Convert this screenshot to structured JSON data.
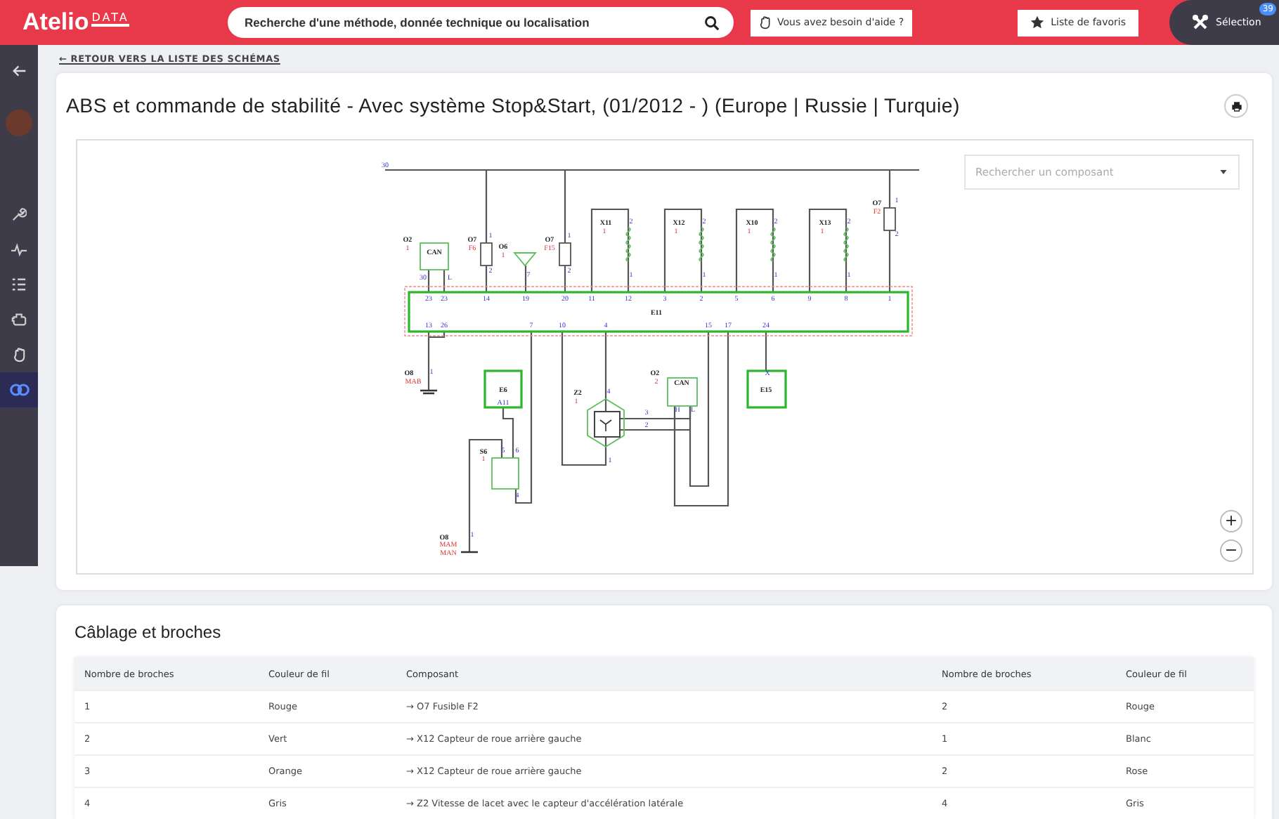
{
  "topbar": {
    "logo": {
      "main": "Atelio",
      "sub": "DATA"
    },
    "search": {
      "placeholder": "Recherche d'une méthode, donnée technique ou localisation"
    },
    "help_button": "Vous avez besoin d'aide ?",
    "favorites_button": "Liste de favoris",
    "selection": {
      "label": "Sélection",
      "badge": "39"
    }
  },
  "sidebar": {
    "items": [
      {
        "kind": "back",
        "selected": false
      },
      {
        "kind": "avatar",
        "selected": false
      },
      {
        "kind": "wrench",
        "selected": false
      },
      {
        "kind": "pulse",
        "selected": false
      },
      {
        "kind": "list",
        "selected": false
      },
      {
        "kind": "engine",
        "selected": false
      },
      {
        "kind": "hand",
        "selected": false
      },
      {
        "kind": "link",
        "selected": true
      }
    ]
  },
  "breadcrumb": "← RETOUR VERS LA LISTE DES SCHÉMAS",
  "title": "ABS et commande de stabilité - Avec système Stop&Start, (01/2012 - ) (Europe | Russie | Turquie)",
  "diagram": {
    "component_search": {
      "placeholder": "Rechercher un composant"
    },
    "labels": [
      {
        "text": "30",
        "kind": "pin"
      },
      {
        "text": "O2",
        "kind": "ref"
      },
      {
        "text": "1",
        "kind": "sub"
      },
      {
        "text": "CAN",
        "kind": "ref"
      },
      {
        "text": "30",
        "kind": "pin"
      },
      {
        "text": "L",
        "kind": "pin"
      },
      {
        "text": "O7",
        "kind": "ref"
      },
      {
        "text": "F6",
        "kind": "sub"
      },
      {
        "text": "1",
        "kind": "pin"
      },
      {
        "text": "2",
        "kind": "pin"
      },
      {
        "text": "O6",
        "kind": "ref"
      },
      {
        "text": "1",
        "kind": "sub"
      },
      {
        "text": "7",
        "kind": "pin"
      },
      {
        "text": "O7",
        "kind": "ref"
      },
      {
        "text": "F15",
        "kind": "sub"
      },
      {
        "text": "1",
        "kind": "pin"
      },
      {
        "text": "2",
        "kind": "pin"
      },
      {
        "text": "X11",
        "kind": "ref"
      },
      {
        "text": "1",
        "kind": "sub"
      },
      {
        "text": "2",
        "kind": "pin"
      },
      {
        "text": "1",
        "kind": "pin"
      },
      {
        "text": "X12",
        "kind": "ref"
      },
      {
        "text": "1",
        "kind": "sub"
      },
      {
        "text": "2",
        "kind": "pin"
      },
      {
        "text": "1",
        "kind": "pin"
      },
      {
        "text": "X10",
        "kind": "ref"
      },
      {
        "text": "1",
        "kind": "sub"
      },
      {
        "text": "2",
        "kind": "pin"
      },
      {
        "text": "1",
        "kind": "pin"
      },
      {
        "text": "X13",
        "kind": "ref"
      },
      {
        "text": "1",
        "kind": "sub"
      },
      {
        "text": "2",
        "kind": "pin"
      },
      {
        "text": "1",
        "kind": "pin"
      },
      {
        "text": "O7",
        "kind": "ref"
      },
      {
        "text": "F2",
        "kind": "sub"
      },
      {
        "text": "1",
        "kind": "pin"
      },
      {
        "text": "2",
        "kind": "pin"
      },
      {
        "text": "23",
        "kind": "pin"
      },
      {
        "text": "23",
        "kind": "pin"
      },
      {
        "text": "14",
        "kind": "pin"
      },
      {
        "text": "19",
        "kind": "pin"
      },
      {
        "text": "20",
        "kind": "pin"
      },
      {
        "text": "11",
        "kind": "pin"
      },
      {
        "text": "12",
        "kind": "pin"
      },
      {
        "text": "3",
        "kind": "pin"
      },
      {
        "text": "2",
        "kind": "pin"
      },
      {
        "text": "5",
        "kind": "pin"
      },
      {
        "text": "6",
        "kind": "pin"
      },
      {
        "text": "9",
        "kind": "pin"
      },
      {
        "text": "8",
        "kind": "pin"
      },
      {
        "text": "1",
        "kind": "pin"
      },
      {
        "text": "E11",
        "kind": "ref"
      },
      {
        "text": "13",
        "kind": "pin"
      },
      {
        "text": "26",
        "kind": "pin"
      },
      {
        "text": "7",
        "kind": "pin"
      },
      {
        "text": "10",
        "kind": "pin"
      },
      {
        "text": "4",
        "kind": "pin"
      },
      {
        "text": "15",
        "kind": "pin"
      },
      {
        "text": "17",
        "kind": "pin"
      },
      {
        "text": "24",
        "kind": "pin"
      },
      {
        "text": "O8",
        "kind": "ref"
      },
      {
        "text": "MAB",
        "kind": "sub"
      },
      {
        "text": "1",
        "kind": "pin"
      },
      {
        "text": "E6",
        "kind": "ref"
      },
      {
        "text": "A11",
        "kind": "pin"
      },
      {
        "text": "Z2",
        "kind": "ref"
      },
      {
        "text": "1",
        "kind": "sub"
      },
      {
        "text": "4",
        "kind": "pin"
      },
      {
        "text": "3",
        "kind": "pin"
      },
      {
        "text": "2",
        "kind": "pin"
      },
      {
        "text": "1",
        "kind": "pin"
      },
      {
        "text": "O2",
        "kind": "ref"
      },
      {
        "text": "2",
        "kind": "sub"
      },
      {
        "text": "CAN",
        "kind": "ref"
      },
      {
        "text": "H",
        "kind": "pin"
      },
      {
        "text": "L",
        "kind": "pin"
      },
      {
        "text": "X",
        "kind": "pin"
      },
      {
        "text": "E15",
        "kind": "ref"
      },
      {
        "text": "S6",
        "kind": "ref"
      },
      {
        "text": "1",
        "kind": "sub"
      },
      {
        "text": "5",
        "kind": "pin"
      },
      {
        "text": "6",
        "kind": "pin"
      },
      {
        "text": "4",
        "kind": "pin"
      },
      {
        "text": "O8",
        "kind": "ref"
      },
      {
        "text": "MAM",
        "kind": "sub"
      },
      {
        "text": "MAN",
        "kind": "sub"
      },
      {
        "text": "1",
        "kind": "pin"
      }
    ],
    "zoom_in": "+",
    "zoom_out": "−"
  },
  "wiring": {
    "title": "Câblage et broches",
    "columns": [
      "Nombre de broches",
      "Couleur de fil",
      "Composant",
      "Nombre de broches",
      "Couleur de fil"
    ],
    "rows": [
      [
        "1",
        "Rouge",
        "→ O7 Fusible F2",
        "2",
        "Rouge"
      ],
      [
        "2",
        "Vert",
        "→ X12 Capteur de roue arrière gauche",
        "1",
        "Blanc"
      ],
      [
        "3",
        "Orange",
        "→ X12 Capteur de roue arrière gauche",
        "2",
        "Rose"
      ],
      [
        "4",
        "Gris",
        "→ Z2 Vitesse de lacet avec le capteur d'accélération latérale",
        "4",
        "Gris"
      ]
    ]
  }
}
